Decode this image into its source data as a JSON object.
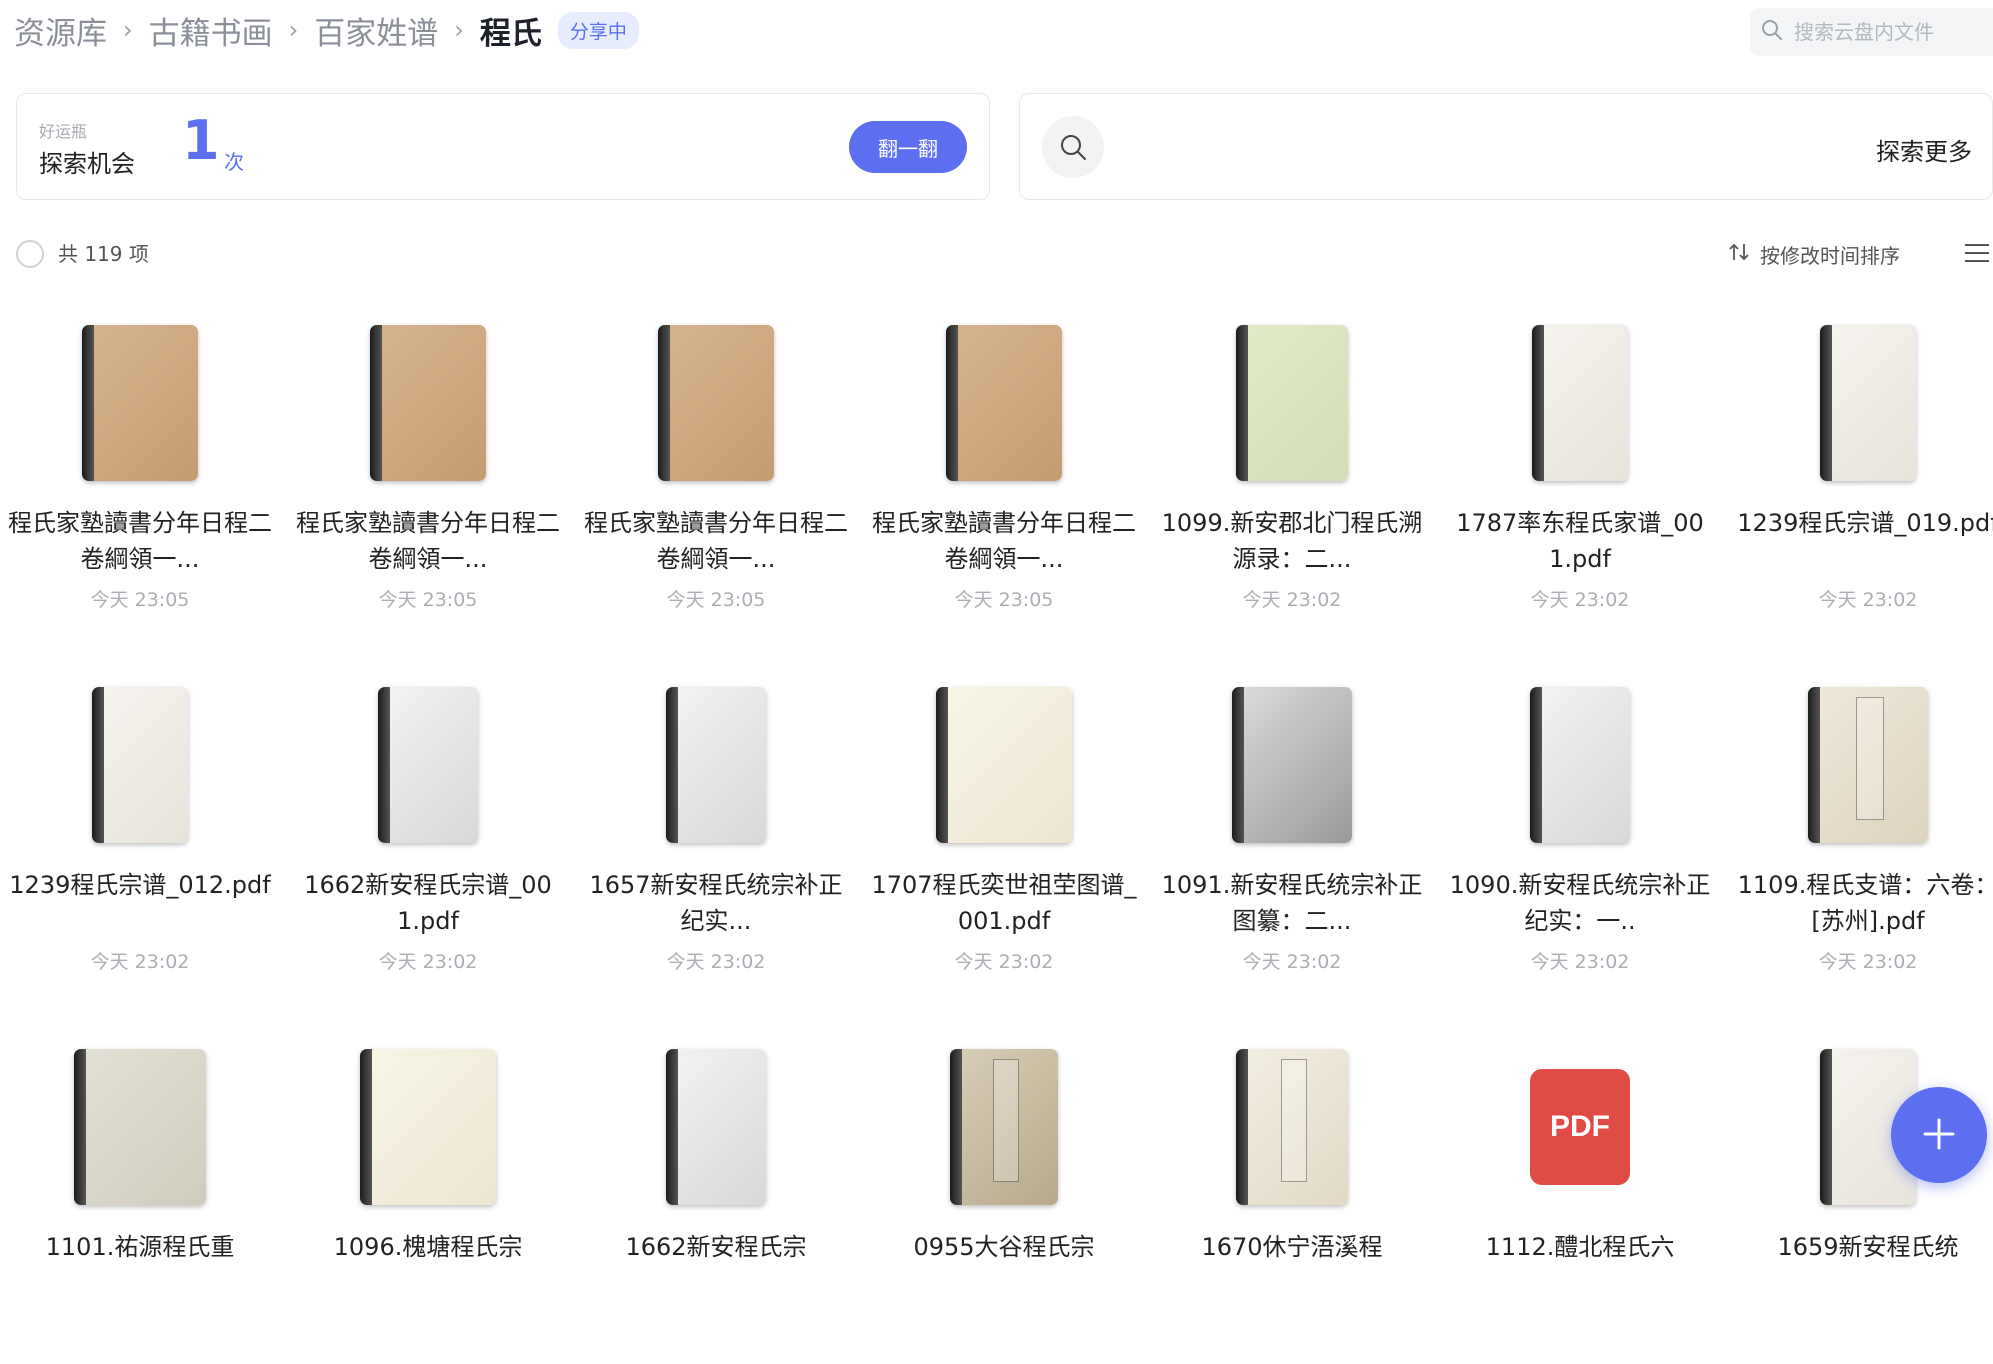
{
  "breadcrumb": {
    "items": [
      "资源库",
      "古籍书画",
      "百家姓谱"
    ],
    "separator": "›",
    "current": "程氏",
    "badge": "分享中"
  },
  "search": {
    "placeholder": "搜索云盘内文件",
    "icon": "search-icon"
  },
  "luck": {
    "small_label": "好运瓶",
    "label": "探索机会",
    "count": "1",
    "unit": "次",
    "button": "翻一翻"
  },
  "explore": {
    "label": "探索更多",
    "icon": "search-icon"
  },
  "toolbar": {
    "count_text": "共 119 项",
    "sort_label": "按修改时间排序",
    "sort_icon": "sort-arrows-icon",
    "view_icon": "list-view-icon"
  },
  "colors": {
    "accent": "#5b6ff0",
    "pdf": "#e04b45",
    "badge_bg": "#e7ecff"
  },
  "files": [
    {
      "name": "程氏家塾讀書分年日程二卷綱領一...",
      "time": "今天 23:05",
      "thumb": "tan-cover"
    },
    {
      "name": "程氏家塾讀書分年日程二卷綱領一...",
      "time": "今天 23:05",
      "thumb": "tan-cover"
    },
    {
      "name": "程氏家塾讀書分年日程二卷綱領一...",
      "time": "今天 23:05",
      "thumb": "tan-cover"
    },
    {
      "name": "程氏家塾讀書分年日程二卷綱領一...",
      "time": "今天 23:05",
      "thumb": "tan-cover"
    },
    {
      "name": "1099.新安郡北门程氏溯源录：二...",
      "time": "今天 23:02",
      "thumb": "green-cover"
    },
    {
      "name": "1787率东程氏家谱_001.pdf",
      "time": "今天 23:02",
      "thumb": "white-cover"
    },
    {
      "name": "1239程氏宗谱_019.pdf",
      "time": "今天 23:02",
      "thumb": "white-cover"
    },
    {
      "name": "1239程氏宗谱_012.pdf",
      "time": "今天 23:02",
      "thumb": "white-cover"
    },
    {
      "name": "1662新安程氏宗谱_001.pdf",
      "time": "今天 23:02",
      "thumb": "grey-cover"
    },
    {
      "name": "1657新安程氏统宗补正纪实...",
      "time": "今天 23:02",
      "thumb": "grey-cover"
    },
    {
      "name": "1707程氏奕世祖茔图谱_001.pdf",
      "time": "今天 23:02",
      "thumb": "cream-cover"
    },
    {
      "name": "1091.新安程氏统宗补正图纂：二...",
      "time": "今天 23:02",
      "thumb": "print-cover"
    },
    {
      "name": "1090.新安程氏统宗补正纪实：一..",
      "time": "今天 23:02",
      "thumb": "grey-cover"
    },
    {
      "name": "1109.程氏支谱：六卷：[苏州].pdf",
      "time": "今天 23:02",
      "thumb": "label-cover"
    },
    {
      "name": "1101.祐源程氏重",
      "time": "",
      "thumb": "olive-cover"
    },
    {
      "name": "1096.槐塘程氏宗",
      "time": "",
      "thumb": "cream-cover"
    },
    {
      "name": "1662新安程氏宗",
      "time": "",
      "thumb": "grey-cover"
    },
    {
      "name": "0955大谷程氏宗",
      "time": "",
      "thumb": "title-cover"
    },
    {
      "name": "1670休宁浯溪程",
      "time": "",
      "thumb": "title-cover-light"
    },
    {
      "name": "1112.醴北程氏六",
      "time": "",
      "thumb": "pdf-icon",
      "pdf_text": "PDF"
    },
    {
      "name": "1659新安程氏统",
      "time": "",
      "thumb": "white-cover"
    }
  ],
  "fab": {
    "icon": "plus-icon"
  }
}
